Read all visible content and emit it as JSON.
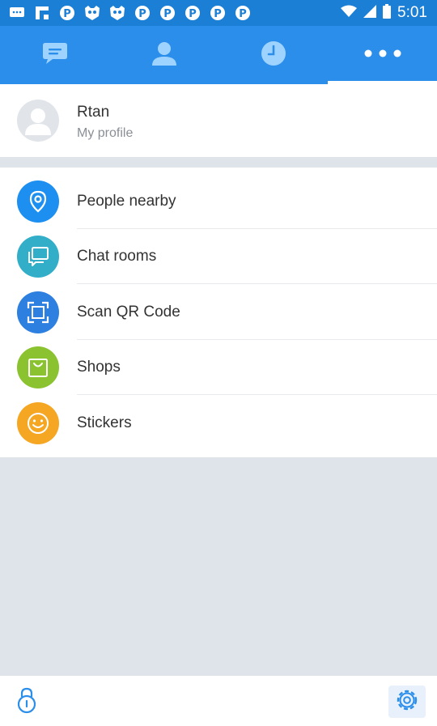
{
  "status_bar": {
    "time": "5:01",
    "notification_icons": [
      "message-icon",
      "flipboard-icon",
      "pinterest-icon",
      "mask-icon",
      "mask-icon",
      "pinterest-icon",
      "pinterest-icon",
      "pinterest-icon",
      "pinterest-icon",
      "pinterest-icon",
      "pinterest-icon"
    ],
    "color": "#1b7fd6"
  },
  "tabs": [
    {
      "icon": "chat-bubble-icon",
      "active": false
    },
    {
      "icon": "person-icon",
      "active": false
    },
    {
      "icon": "clock-icon",
      "active": false
    },
    {
      "icon": "more-icon",
      "active": true
    }
  ],
  "profile": {
    "name": "Rtan",
    "subtitle": "My profile"
  },
  "menu": [
    {
      "label": "People nearby",
      "icon": "location-pin-icon",
      "color": "#1c8ff0"
    },
    {
      "label": "Chat rooms",
      "icon": "chat-rooms-icon",
      "color": "#33aec8"
    },
    {
      "label": "Scan QR Code",
      "icon": "scan-qr-icon",
      "color": "#2d80e0"
    },
    {
      "label": "Shops",
      "icon": "shopping-bag-icon",
      "color": "#8bc22f"
    },
    {
      "label": "Stickers",
      "icon": "smiley-icon",
      "color": "#f5a623"
    }
  ],
  "bottom_bar": {
    "lock_icon": "lock-icon",
    "settings_icon": "gear-icon"
  },
  "colors": {
    "accent": "#2a8eea",
    "background": "#dfe3ea"
  }
}
